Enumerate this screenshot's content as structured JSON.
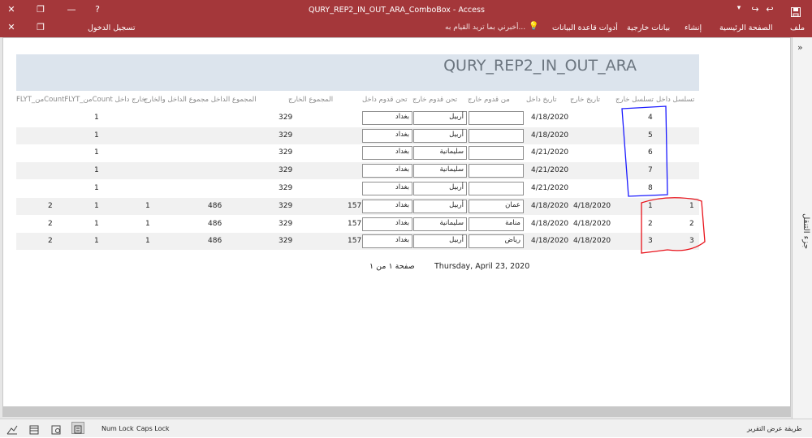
{
  "window": {
    "title": "QURY_REP2_IN_OUT_ARA_ComboBox - Access",
    "help_glyph": "?",
    "sign_in": "تسجيل الدخول"
  },
  "ribbon": {
    "tabs": [
      "ملف",
      "الصفحة الرئيسية",
      "إنشاء",
      "بيانات خارجية",
      "أدوات قاعدة البيانات"
    ],
    "tell_me": "أخبرني بما تريد القيام به..."
  },
  "report": {
    "title": "QURY_REP2_IN_OUT_ARA",
    "columns": {
      "seq_in": "تسلسل داخل",
      "seq_out": "تسلسل خارج",
      "date_out": "تاريخ خارج",
      "date_in": "تاريخ داخل",
      "from_arrival_out": "من قدوم خارج",
      "to_arrival_out": "تحن قدوم خارج",
      "to_arrival_in": "تحن قدوم داخل",
      "total_out": "المجموع الخارج",
      "total_in_out": "المجموع الداخل مجموع الداخل والخارج",
      "count_cols": "FLYT_منCountFLYT_منCount خارج داخل"
    },
    "rows": [
      {
        "seq_in": "",
        "seq_out": "4",
        "date_out": "",
        "date_in": "4/18/2020",
        "from_box": "",
        "to_out_box": "أربيل",
        "to_in_box": "بغداد",
        "v157": "",
        "v329": "329",
        "v486": "",
        "c1": "",
        "c2": "1",
        "c3": ""
      },
      {
        "seq_in": "",
        "seq_out": "5",
        "date_out": "",
        "date_in": "4/18/2020",
        "from_box": "",
        "to_out_box": "أربيل",
        "to_in_box": "بغداد",
        "v157": "",
        "v329": "329",
        "v486": "",
        "c1": "",
        "c2": "1",
        "c3": ""
      },
      {
        "seq_in": "",
        "seq_out": "6",
        "date_out": "",
        "date_in": "4/21/2020",
        "from_box": "",
        "to_out_box": "سليمانية",
        "to_in_box": "بغداد",
        "v157": "",
        "v329": "329",
        "v486": "",
        "c1": "",
        "c2": "1",
        "c3": ""
      },
      {
        "seq_in": "",
        "seq_out": "7",
        "date_out": "",
        "date_in": "4/21/2020",
        "from_box": "",
        "to_out_box": "سليمانية",
        "to_in_box": "بغداد",
        "v157": "",
        "v329": "329",
        "v486": "",
        "c1": "",
        "c2": "1",
        "c3": ""
      },
      {
        "seq_in": "",
        "seq_out": "8",
        "date_out": "",
        "date_in": "4/21/2020",
        "from_box": "",
        "to_out_box": "أربيل",
        "to_in_box": "بغداد",
        "v157": "",
        "v329": "329",
        "v486": "",
        "c1": "",
        "c2": "1",
        "c3": ""
      },
      {
        "seq_in": "1",
        "seq_out": "1",
        "date_out": "4/18/2020",
        "date_in": "4/18/2020",
        "from_box": "عمان",
        "to_out_box": "أربيل",
        "to_in_box": "بغداد",
        "v157": "157",
        "v329": "329",
        "v486": "486",
        "c1": "1",
        "c2": "1",
        "c3": "2"
      },
      {
        "seq_in": "2",
        "seq_out": "2",
        "date_out": "4/18/2020",
        "date_in": "4/18/2020",
        "from_box": "منامة",
        "to_out_box": "سليمانية",
        "to_in_box": "بغداد",
        "v157": "157",
        "v329": "329",
        "v486": "486",
        "c1": "1",
        "c2": "1",
        "c3": "2"
      },
      {
        "seq_in": "3",
        "seq_out": "3",
        "date_out": "4/18/2020",
        "date_in": "4/18/2020",
        "from_box": "رياض",
        "to_out_box": "أربيل",
        "to_in_box": "بغداد",
        "v157": "157",
        "v329": "329",
        "v486": "486",
        "c1": "1",
        "c2": "1",
        "c3": "2"
      }
    ],
    "footer_date": "Thursday, April 23, 2020",
    "footer_page": "صفحة ١ من ١"
  },
  "nav_pane": {
    "label": "جزء التنقل",
    "collapse_glyph": "»"
  },
  "statusbar": {
    "view_label": "طريقة عرض التقرير",
    "num_lock": "Num Lock",
    "caps_lock": "Caps Lock"
  },
  "colors": {
    "accent": "#a4373a",
    "header_band": "#dce4ed",
    "annot_blue": "#1a1aff",
    "annot_red": "#e8121a"
  }
}
